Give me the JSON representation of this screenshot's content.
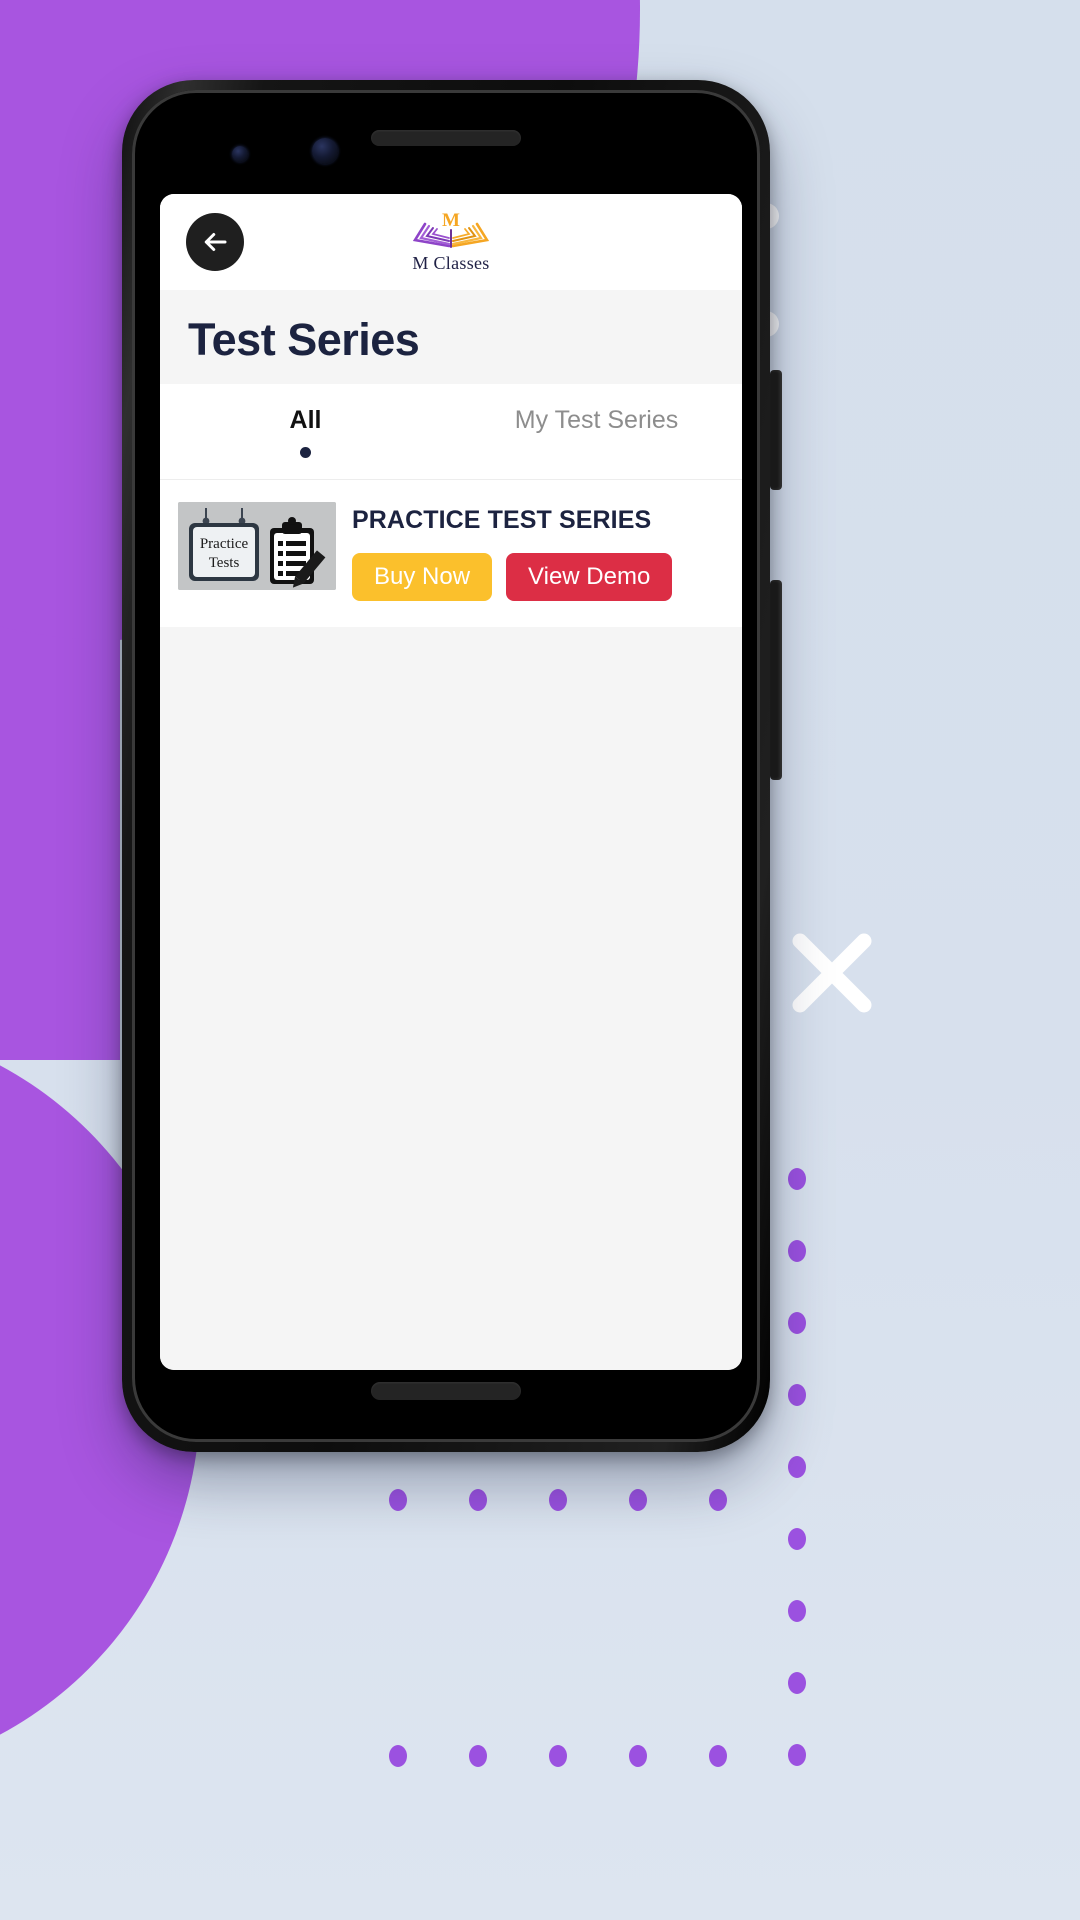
{
  "brand": {
    "name": "M Classes",
    "logo_icon": "open-book-logo",
    "logo_letter": "M",
    "colors": {
      "purple": "#8e44c8",
      "orange": "#f5a623",
      "navy": "#1f2045"
    }
  },
  "appbar": {
    "back_icon": "arrow-left-icon",
    "back_label": "Back"
  },
  "page": {
    "title": "Test Series"
  },
  "tabs": [
    {
      "label": "All",
      "active": true
    },
    {
      "label": "My Test Series",
      "active": false
    }
  ],
  "cards": [
    {
      "title": "PRACTICE TEST SERIES",
      "thumbnail_icon": "practice-tests-thumbnail",
      "thumbnail_text_line1": "Practice",
      "thumbnail_text_line2": "Tests",
      "buy_label": "Buy Now",
      "demo_label": "View Demo",
      "buy_color": "#fbc02c",
      "demo_color": "#dc2e45"
    }
  ],
  "theme": {
    "accent_purple": "#a855e0",
    "backdrop_blue": "#d7e0ed",
    "title_navy": "#1c2340",
    "screen_bg": "#f5f5f5"
  }
}
